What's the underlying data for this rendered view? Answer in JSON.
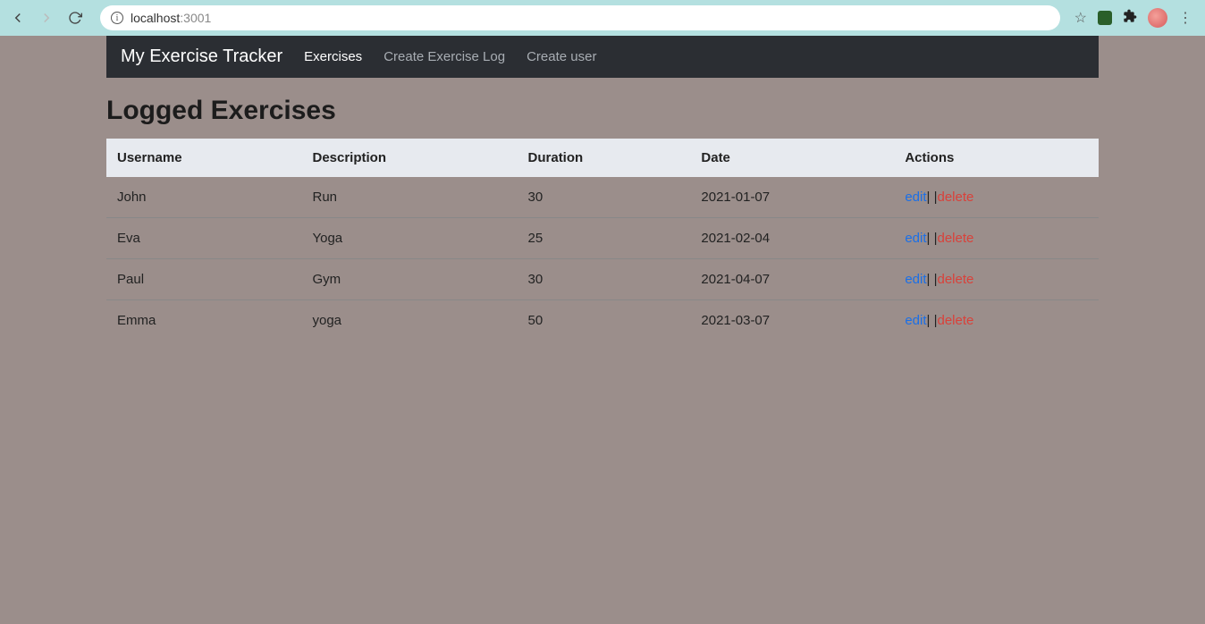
{
  "browser": {
    "url_host": "localhost",
    "url_port": ":3001"
  },
  "navbar": {
    "brand": "My Exercise Tracker",
    "links": [
      {
        "label": "Exercises",
        "active": true
      },
      {
        "label": "Create Exercise Log",
        "active": false
      },
      {
        "label": "Create user",
        "active": false
      }
    ]
  },
  "page": {
    "title": "Logged Exercises"
  },
  "table": {
    "headers": [
      "Username",
      "Description",
      "Duration",
      "Date",
      "Actions"
    ],
    "edit_label": "edit",
    "delete_label": "delete",
    "separator": "| |",
    "rows": [
      {
        "username": "John",
        "description": "Run",
        "duration": "30",
        "date": "2021-01-07"
      },
      {
        "username": "Eva",
        "description": "Yoga",
        "duration": "25",
        "date": "2021-02-04"
      },
      {
        "username": "Paul",
        "description": "Gym",
        "duration": "30",
        "date": "2021-04-07"
      },
      {
        "username": "Emma",
        "description": "yoga",
        "duration": "50",
        "date": "2021-03-07"
      }
    ]
  }
}
